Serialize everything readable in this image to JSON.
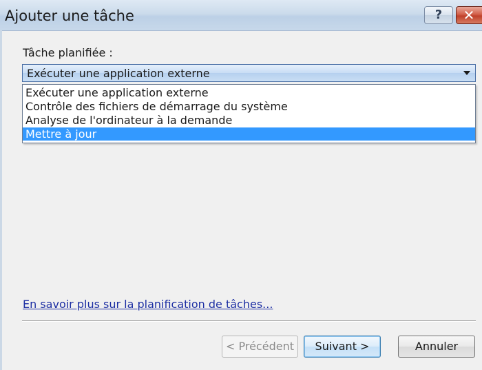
{
  "window": {
    "title": "Ajouter une tâche",
    "help_glyph": "?",
    "close_glyph": "✕"
  },
  "form": {
    "task_label": "Tâche planifiée :",
    "selected_value": "Exécuter une application externe",
    "options": [
      "Exécuter une application externe",
      "Contrôle des fichiers de démarrage du système",
      "Analyse de l'ordinateur à la demande",
      "Mettre à jour"
    ],
    "highlighted_option": "Mettre à jour"
  },
  "link": {
    "text": "En savoir plus sur la planification de tâches..."
  },
  "buttons": {
    "previous": "< Précédent",
    "next": "Suivant >",
    "cancel": "Annuler"
  },
  "colors": {
    "selection": "#3399ff",
    "link": "#1c2ea3",
    "close_button": "#c0412b"
  }
}
